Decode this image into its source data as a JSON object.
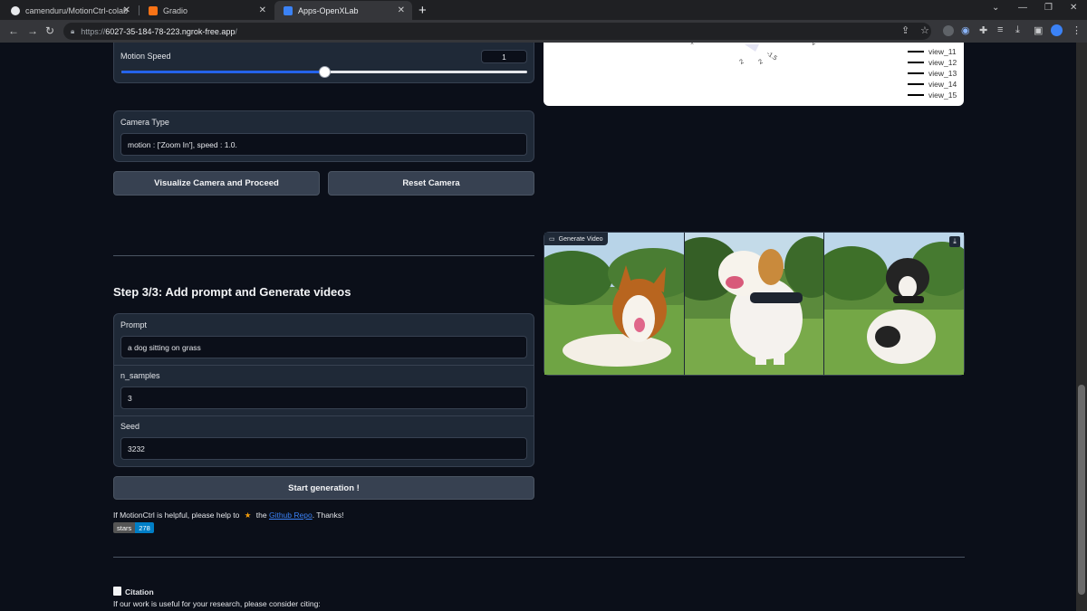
{
  "browser": {
    "tabs": [
      {
        "title": "camenduru/MotionCtrl-colab"
      },
      {
        "title": "Gradio"
      },
      {
        "title": "Apps-OpenXLab"
      }
    ],
    "url_scheme": "https://",
    "url_host": "6027-35-184-78-223.ngrok-free.app",
    "url_path": "/"
  },
  "motion_speed": {
    "label": "Motion Speed",
    "value": "1",
    "slider_fraction": 0.5
  },
  "camera_type": {
    "label": "Camera Type",
    "value": "motion : ['Zoom In'], speed : 1.0."
  },
  "buttons": {
    "visualize": "Visualize Camera and Proceed",
    "reset": "Reset Camera",
    "start": "Start generation !"
  },
  "step3": {
    "title": "Step 3/3: Add prompt and Generate videos"
  },
  "prompt": {
    "label": "Prompt",
    "value": "a dog sitting on grass"
  },
  "n_samples": {
    "label": "n_samples",
    "value": "3"
  },
  "seed": {
    "label": "Seed",
    "value": "3232"
  },
  "help": {
    "prefix": "If MotionCtrl is helpful, please help to",
    "star": "★",
    "the": "the",
    "link": "Github Repo",
    "suffix": ". Thanks!"
  },
  "badge": {
    "label": "stars",
    "count": "278"
  },
  "citation": {
    "title": "Citation",
    "text": "If our work is useful for your research, please consider citing:"
  },
  "plot_legend": [
    "view_11",
    "view_12",
    "view_13",
    "view_14",
    "view_15"
  ],
  "plot_ticks": [
    "2",
    "2",
    "-1.5",
    "-1",
    "2"
  ],
  "video": {
    "label": "Generate Video"
  },
  "colors": {
    "accent": "#2563eb",
    "background": "#0b0f19",
    "panel": "#1f2937",
    "link": "#3b82f6"
  }
}
